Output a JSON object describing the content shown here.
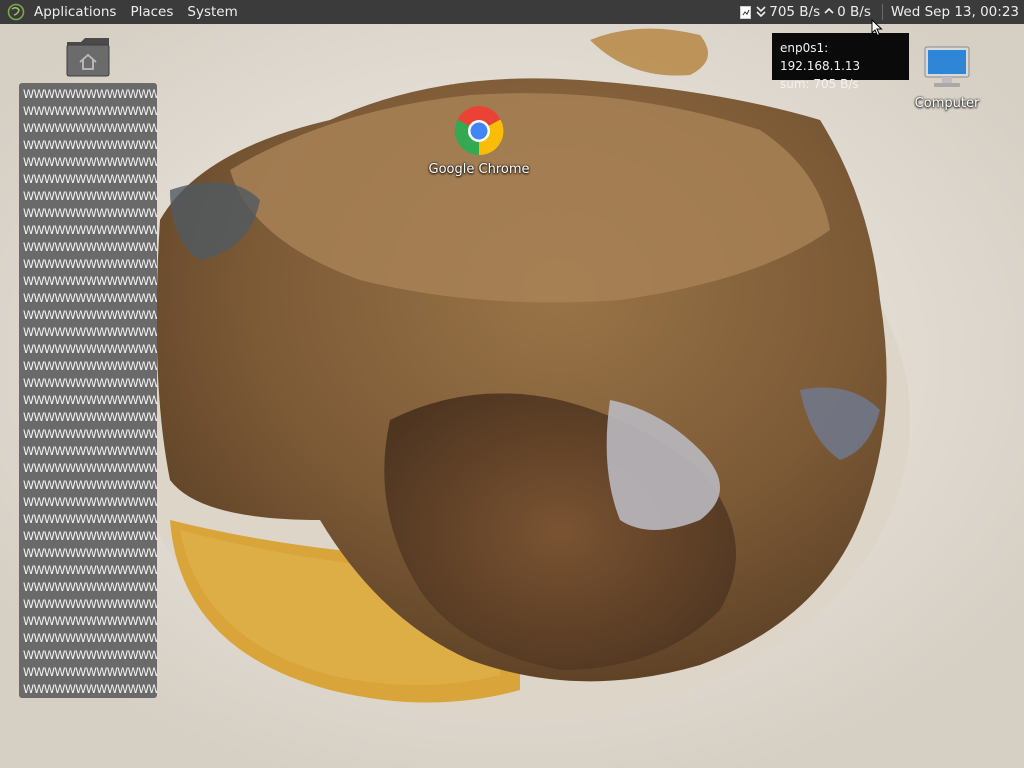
{
  "panel": {
    "menus": [
      "Applications",
      "Places",
      "System"
    ],
    "net_down": "705 B/s",
    "net_up": "0 B/s",
    "clock": "Wed Sep 13, 00:23"
  },
  "tooltip": {
    "line1": "enp0s1: 192.168.1.13",
    "line2": "sum: 705 B/s"
  },
  "desktop": {
    "icons": [
      {
        "name": "home-folder",
        "label": ""
      },
      {
        "name": "google-chrome",
        "label": "Google Chrome"
      },
      {
        "name": "computer",
        "label": "Computer"
      }
    ]
  },
  "text_panel": {
    "line_text": "WWWWWWWWWWWWW",
    "lines": [
      "WWWWWWWWWWWWW",
      "WWWWWWWWWWWWW",
      "WWWWWWWWWWWWW",
      "WWWWWWWWWWWWW",
      "WWWWWWWWWWWWW",
      "WWWWWWWWWWWWW",
      "WWWWWWWWWWWWW",
      "WWWWWWWWWWWWW",
      "WWWWWWWWWWWWW",
      "WWWWWWWWWWWWW",
      "WWWWWWWWWWWWW",
      "WWWWWWWWWWWWW",
      "WWWWWWWWWWWWW",
      "WWWWWWWWWWWWW",
      "WWWWWWWWWWWWW",
      "WWWWWWWWWWWWW",
      "WWWWWWWWWWWWW",
      "WWWWWWWWWWWWW",
      "WWWWWWWWWWWWW",
      "WWWWWWWWWWWWW",
      "WWWWWWWWWWWWW",
      "WWWWWWWWWWWWW",
      "WWWWWWWWWWWWW",
      "WWWWWWWWWWWWW",
      "WWWWWWWWWWWWW",
      "WWWWWWWWWWWWW",
      "WWWWWWWWWWWWW",
      "WWWWWWWWWWWWW",
      "WWWWWWWWWWWWW",
      "WWWWWWWWWWWWW",
      "WWWWWWWWWWWWW",
      "WWWWWWWWWWWWW",
      "WWWWWWWWWWWWW",
      "WWWWWWWWWWWWW",
      "WWWWWWWWWWWWW",
      "WWWWWWWWWWWWW"
    ]
  },
  "colors": {
    "panel_bg": "#3b3b3b",
    "tooltip_bg": "#0a0a0a",
    "text_panel_bg": "#6a6a6a"
  }
}
